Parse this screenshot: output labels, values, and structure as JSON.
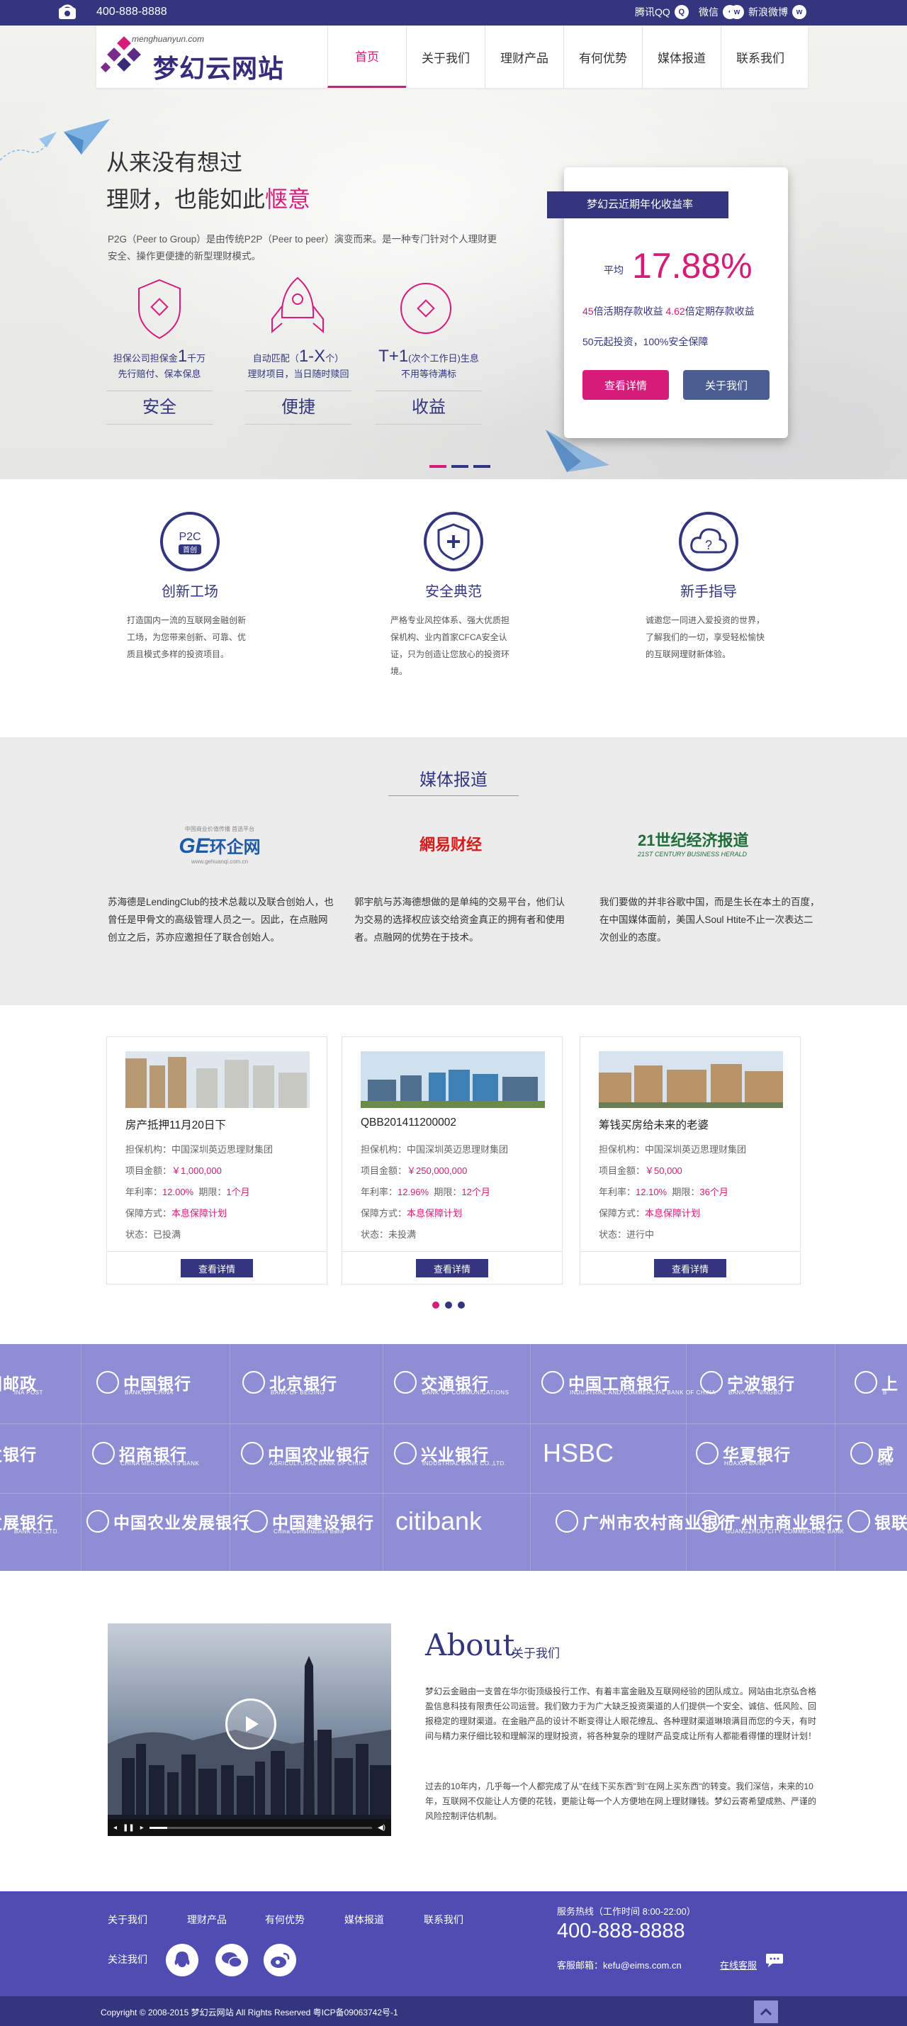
{
  "topbar": {
    "phone": "400-888-8888",
    "qq": "腾讯QQ",
    "wechat": "微信",
    "weibo": "新浪微博"
  },
  "logo": {
    "url": "menghuanyun.com",
    "name": "梦幻云网站"
  },
  "nav": [
    "首页",
    "关于我们",
    "理财产品",
    "有何优势",
    "媒体报道",
    "联系我们"
  ],
  "hero": {
    "line1": "从来没有想过",
    "line2_prefix": "理财，也能如此",
    "line2_highlight": "惬意",
    "desc": "P2G（Peer to Group）是由传统P2P（Peer to peer）演变而来。是一种专门针对个人理财更安全、操作更便捷的新型理财模式。",
    "features": [
      {
        "pre": "担保公司担保金",
        "num": "1",
        "post": "千万",
        "line2": "先行赔付、保本保息",
        "label": "安全"
      },
      {
        "pre": "自动匹配（",
        "num": "1-X",
        "post": "个）",
        "line2": "理财项目，当日随时赎回",
        "label": "便捷"
      },
      {
        "pre": "",
        "num": "T+1",
        "post": "(次个工作日)生息",
        "line2": "不用等待满标",
        "label": "收益"
      }
    ]
  },
  "rate_card": {
    "ribbon": "梦幻云近期年化收益率",
    "avg_label": "平均",
    "rate": "17.88%",
    "n1": "45",
    "t1": "倍活期存款收益",
    "n2": "4.62",
    "t2": "倍定期存款收益",
    "line3": "50元起投资，100%安全保障",
    "btn_detail": "查看详情",
    "btn_about": "关于我们"
  },
  "features2": [
    {
      "icon": "p2c-icon",
      "badge": "P2C",
      "badge2": "首创",
      "title": "创新工场",
      "text": "打造国内一流的互联网金融创新工场，为您带来创新、可靠、优质且模式多样的投资项目。"
    },
    {
      "icon": "shield-icon",
      "title": "安全典范",
      "text": "严格专业风控体系、强大优质担保机构、业内首家CFCA安全认证，只为创造让您放心的投资环境。"
    },
    {
      "icon": "cloud-question-icon",
      "title": "新手指导",
      "text": "诚邀您一同进入爱投资的世界，了解我们的一切，享受轻松愉快的互联网理财新体验。"
    }
  ],
  "media": {
    "title": "媒体报道",
    "logos": [
      "环企网",
      "網易财经",
      "21世纪经济报道"
    ],
    "logo_subs": [
      "中国商业价值传播 首选平台",
      "",
      "21ST CENTURY BUSINESS HERALD"
    ],
    "logo_url": "www.gehuanqi.com.cn",
    "texts": [
      "苏海德是LendingClub的技术总裁以及联合创始人，也曾任是甲骨文的高级管理人员之一。因此，在点融网创立之后，苏亦应邀担任了联合创始人。",
      "郭宇航与苏海德想做的是单纯的交易平台，他们认为交易的选择权应该交给资金真正的拥有者和使用者。点融网的优势在于技术。",
      "我们要做的并非谷歌中国，而是生长在本土的百度，在中国媒体面前，美国人Soul Htite不止一次表达二次创业的态度。"
    ]
  },
  "products": [
    {
      "name": "房产抵押11月20日下",
      "org": "中国深圳英迈思理财集团",
      "amount": "￥1,000,000",
      "rate": "12.00%",
      "term": "1个月",
      "guarantee": "本息保障计划",
      "status": "已投满",
      "btn": "查看详情"
    },
    {
      "name": "QBB201411200002",
      "org": "中国深圳英迈思理财集团",
      "amount": "￥250,000,000",
      "rate": "12.96%",
      "term": "12个月",
      "guarantee": "本息保障计划",
      "status": "未投满",
      "btn": "查看详情"
    },
    {
      "name": "筹钱买房给未来的老婆",
      "org": "中国深圳英迈思理财集团",
      "amount": "￥50,000",
      "rate": "12.10%",
      "term": "36个月",
      "guarantee": "本息保障计划",
      "status": "进行中",
      "btn": "查看详情"
    }
  ],
  "product_labels": {
    "org": "担保机构：",
    "amount": "项目金额：",
    "rate": "年利率：",
    "term": "期限：",
    "guarantee": "保障方式：",
    "status": "状态："
  },
  "banks": {
    "row1": [
      {
        "cn": "国邮政",
        "en": "INA POST"
      },
      {
        "cn": "中国银行",
        "en": "BANK OF CHINA"
      },
      {
        "cn": "北京银行",
        "en": "BANK OF BEIJING"
      },
      {
        "cn": "交通银行",
        "en": "BANK OF COMMUNICATIONS"
      },
      {
        "cn": "中国工商银行",
        "en": "INDUSTRIAL AND COMMERCIAL BANK OF CHINA"
      },
      {
        "cn": "宁波银行",
        "en": "BANK OF NINGBO"
      },
      {
        "cn": "上",
        "en": "B"
      }
    ],
    "row2": [
      {
        "cn": "发银行",
        "en": ""
      },
      {
        "cn": "招商银行",
        "en": "CHINA MERCHANTS BANK"
      },
      {
        "cn": "中国农业银行",
        "en": "AGRICULTURAL BANK OF CHINA"
      },
      {
        "cn": "兴业银行",
        "en": "INDUSTRIAL BANK CO.,LTD."
      },
      {
        "cn": "HSBC",
        "en": ""
      },
      {
        "cn": "华夏银行",
        "en": "HUAXIA BANK"
      },
      {
        "cn": "威",
        "en": "SHE"
      }
    ],
    "row3": [
      {
        "cn": "发展银行",
        "en": "BANK CO.,LTD."
      },
      {
        "cn": "中国农业发展银行",
        "en": ""
      },
      {
        "cn": "中国建设银行",
        "en": "China Construction Bank"
      },
      {
        "cn": "citibank",
        "en": ""
      },
      {
        "cn": "广州市农村商业银行",
        "en": ""
      },
      {
        "cn": "广州市商业银行",
        "en": "GUANGZHOU CITY COMMERCIAL BANK"
      },
      {
        "cn": "银联",
        "en": ""
      }
    ]
  },
  "about": {
    "title": "About",
    "subtitle": "关于我们",
    "p1": "梦幻云金融由一支曾在华尔街顶级投行工作、有着丰富金融及互联网经验的团队成立。网站由北京弘合格盈信息科技有限责任公司运营。我们致力于为广大缺乏投资渠道的人们提供一个安全、诚信、低风险、回报稳定的理财渠道。在金融产品的设计不断变得让人眼花缭乱、各种理财渠道琳琅满目而您的今天，有时间与精力来仔细比较和理解深的理财投资，将各种复杂的理财产品变成让所有人都能看得懂的理财计划！",
    "p2": "过去的10年内，几乎每一个人都完成了从\"在线下买东西\"到\"在网上买东西\"的转变。我们深信，未来的10年，互联网不仅能让人方便的花钱，更能让每一个人方便地在网上理财赚钱。梦幻云寄希望成熟、严谨的风险控制评估机制。"
  },
  "footer": {
    "nav": [
      "关于我们",
      "理财产品",
      "有何优势",
      "媒体报道",
      "联系我们"
    ],
    "follow": "关注我们",
    "hotline_label": "服务热线（工作时间  8:00-22:00）",
    "hotline": "400-888-8888",
    "email": "客服邮箱：kefu@eims.com.cn",
    "online": "在线客服",
    "copyright": "Copyright  ©   2008-2015  梦幻云网站  All Rights Reserved    粤ICP备09063742号-1"
  },
  "colors": {
    "primary": "#33367f",
    "accent": "#d51c79",
    "bank_bg": "#8f8ed4",
    "footer_bg": "#4f4db4"
  }
}
